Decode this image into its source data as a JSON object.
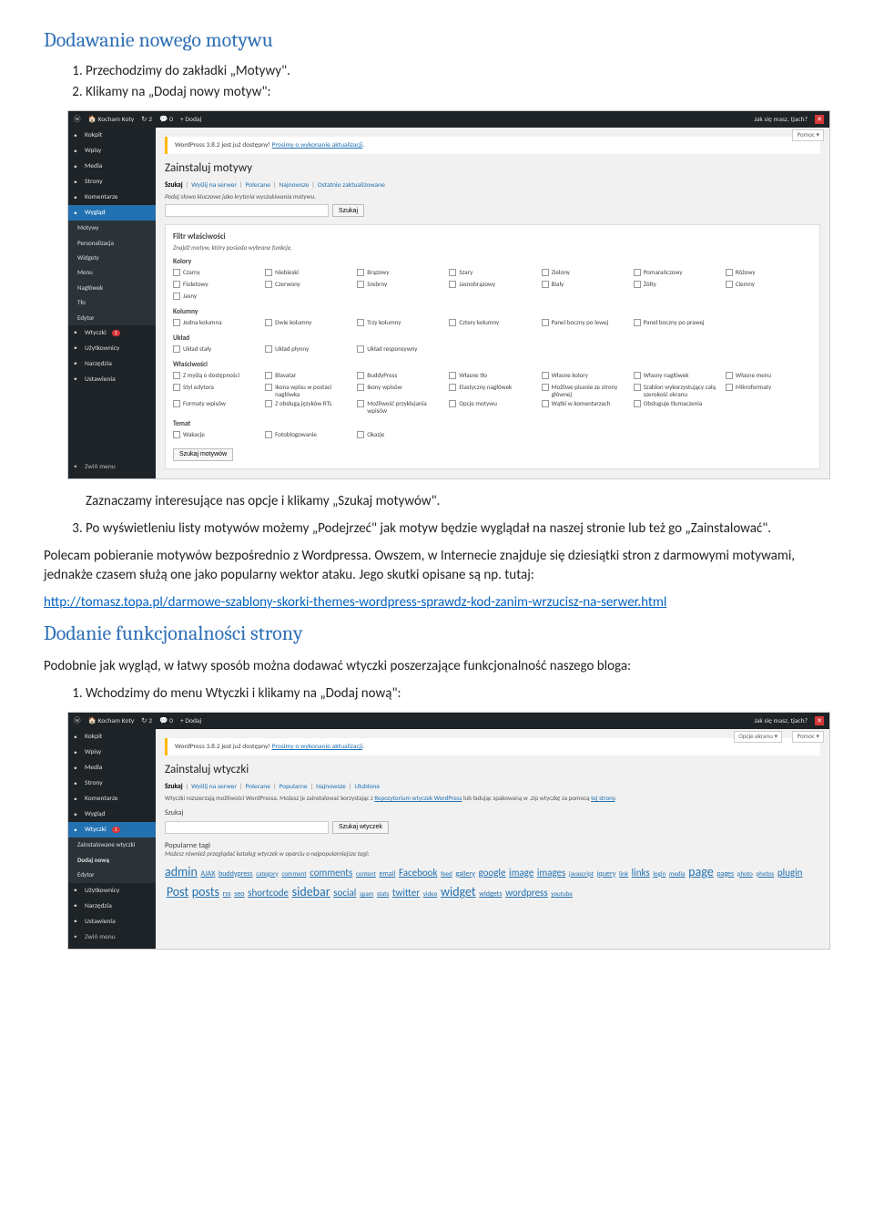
{
  "doc": {
    "h1": "Dodawanie nowego motywu",
    "step1": "Przechodzimy do zakładki „Motywy\".",
    "step2": "Klikamy na „Dodaj nowy motyw\":",
    "after1": "Zaznaczamy interesujące nas opcje i klikamy „Szukaj motywów\".",
    "step3": "Po wyświetleniu listy motywów możemy „Podejrzeć\" jak motyw będzie wyglądał na naszej stronie lub też go „Zainstalować\".",
    "para1": "Polecam pobieranie motywów bezpośrednio z Wordpressa. Owszem, w Internecie znajduje się dziesiątki stron z darmowymi motywami, jednakże czasem służą one jako popularny wektor ataku. Jego skutki opisane są np. tutaj:",
    "link": "http://tomasz.topa.pl/darmowe-szablony-skorki-themes-wordpress-sprawdz-kod-zanim-wrzucisz-na-serwer.html",
    "h2": "Dodanie funkcjonalności strony",
    "para2": "Podobnie jak wygląd, w łatwy sposób można dodawać wtyczki poszerzające funkcjonalność naszego bloga:",
    "lstep1": "Wchodzimy do menu Wtyczki i klikamy na „Dodaj nową\":"
  },
  "shot1": {
    "topbar": {
      "site": "Kocham Koty",
      "comments": "2",
      "updates": "0",
      "add": "Dodaj",
      "greeting": "Jak się masz, tjach?"
    },
    "sidebar": [
      {
        "label": "Kokpit",
        "icon": "dashboard"
      },
      {
        "label": "Wpisy",
        "icon": "pin"
      },
      {
        "label": "Media",
        "icon": "camera"
      },
      {
        "label": "Strony",
        "icon": "pages"
      },
      {
        "label": "Komentarze",
        "icon": "comment"
      },
      {
        "label": "Wygląd",
        "icon": "brush",
        "active": true
      },
      {
        "label": "Motywy",
        "sub": true
      },
      {
        "label": "Personalizacja",
        "sub": true
      },
      {
        "label": "Widgety",
        "sub": true
      },
      {
        "label": "Menu",
        "sub": true
      },
      {
        "label": "Nagłówek",
        "sub": true
      },
      {
        "label": "Tło",
        "sub": true
      },
      {
        "label": "Edytor",
        "sub": true
      },
      {
        "label": "Wtyczki",
        "icon": "plugin",
        "badge": "1"
      },
      {
        "label": "Użytkownicy",
        "icon": "users"
      },
      {
        "label": "Narzędzia",
        "icon": "tools"
      },
      {
        "label": "Ustawienia",
        "icon": "settings"
      },
      {
        "label": "Zwiń menu",
        "icon": "collapse",
        "collapse": true
      }
    ],
    "help": "Pomoc",
    "notice_pre": "WordPress 3.8.2 jest już dostępny! ",
    "notice_link": "Prosimy o wykonanie aktualizacji",
    "title": "Zainstaluj motywy",
    "tabs": [
      "Szukaj",
      "Wyślij na serwer",
      "Polecane",
      "Najnowsze",
      "Ostatnio zaktualizowane"
    ],
    "hint": "Podaj słowo kluczowe jako kryteria wyszukiwania motywu.",
    "search_btn": "Szukaj",
    "filter_title": "Filtr właściwości",
    "filter_hint": "Znajdź motyw, który posiada wybrane funkcje.",
    "groups": [
      {
        "name": "Kolory",
        "items": [
          "Czarny",
          "Niebieski",
          "Brązowy",
          "Szary",
          "Zielony",
          "Pomarańczowy",
          "Różowy",
          "Fioletowy",
          "Czerwony",
          "Srebrny",
          "Jasnobrązowy",
          "Biały",
          "Żółty",
          "Ciemny",
          "Jasny"
        ]
      },
      {
        "name": "Kolumny",
        "items": [
          "Jedna kolumna",
          "Dwie kolumny",
          "Trzy kolumny",
          "Cztery kolumny",
          "Panel boczny po lewej",
          "Panel boczny po prawej"
        ]
      },
      {
        "name": "Układ",
        "items": [
          "Układ stały",
          "Układ płynny",
          "Układ responsywny"
        ]
      },
      {
        "name": "Właściwości",
        "items": [
          "Z myślą o dostępności",
          "Blavatar",
          "BuddyPress",
          "Własne tło",
          "Własne kolory",
          "Własny nagłówek",
          "Własne menu",
          "Styl edytora",
          "Ikona wpisu w postaci nagłówka",
          "Ikony wpisów",
          "Elastyczny nagłówek",
          "Możliwe pisanie ze strony głównej",
          "Szablon wykorzystujący całą szerokość ekranu",
          "Mikroformaty",
          "Formaty wpisów",
          "Z obsługą języków RTL",
          "Możliwość przyklejania wpisów",
          "Opcje motywu",
          "Wątki w komentarzach",
          "Obsługuje tłumaczenia"
        ]
      },
      {
        "name": "Temat",
        "items": [
          "Wakacje",
          "Fotoblogowanie",
          "Okazje"
        ]
      }
    ],
    "submit": "Szukaj motywów"
  },
  "shot2": {
    "topbar": {
      "site": "Kocham Koty",
      "comments": "2",
      "updates": "0",
      "add": "Dodaj",
      "greeting": "Jak się masz, tjach?"
    },
    "sidebar": [
      {
        "label": "Kokpit",
        "icon": "dashboard"
      },
      {
        "label": "Wpisy",
        "icon": "pin"
      },
      {
        "label": "Media",
        "icon": "camera"
      },
      {
        "label": "Strony",
        "icon": "pages"
      },
      {
        "label": "Komentarze",
        "icon": "comment"
      },
      {
        "label": "Wygląd",
        "icon": "brush"
      },
      {
        "label": "Wtyczki",
        "icon": "plugin",
        "badge": "1",
        "active": true
      },
      {
        "label": "Zainstalowane wtyczki",
        "sub": true
      },
      {
        "label": "Dodaj nową",
        "sub": true,
        "bold": true
      },
      {
        "label": "Edytor",
        "sub": true
      },
      {
        "label": "Użytkownicy",
        "icon": "users"
      },
      {
        "label": "Narzędzia",
        "icon": "tools"
      },
      {
        "label": "Ustawienia",
        "icon": "settings"
      },
      {
        "label": "Zwiń menu",
        "icon": "collapse",
        "collapse": true
      }
    ],
    "screen_options": "Opcje ekranu",
    "help": "Pomoc",
    "notice_pre": "WordPress 3.8.2 jest już dostępny! ",
    "notice_link": "Prosimy o wykonanie aktualizacji",
    "title": "Zainstaluj wtyczki",
    "tabs": [
      "Szukaj",
      "Wyślij na serwer",
      "Polecane",
      "Popularne",
      "Najnowsze",
      "Ulubione"
    ],
    "desc_pre": "Wtyczki rozszerzają możliwości WordPressa. Możesz je zainstalować korzystając z ",
    "desc_link": "Repozytorium wtyczek WordPress",
    "desc_post": " lub ładując spakowaną w .zip wtyczkę za pomocą ",
    "desc_link2": "tej strony",
    "desc_dot": ".",
    "search_label": "Szukaj",
    "search_btn": "Szukaj wtyczek",
    "popular_title": "Popularne tagi",
    "popular_hint": "Możesz również przeglądać katalog wtyczek w oparciu o najpopularniejsze tagi:",
    "tags": [
      {
        "t": "admin",
        "s": "big"
      },
      {
        "t": "AJAX",
        "s": "sm"
      },
      {
        "t": "buddypress",
        "s": "sm"
      },
      {
        "t": "category",
        "s": "xs"
      },
      {
        "t": "comment",
        "s": "xs"
      },
      {
        "t": "comments",
        "s": "med"
      },
      {
        "t": "content",
        "s": "xs"
      },
      {
        "t": "email",
        "s": "sm"
      },
      {
        "t": "Facebook",
        "s": "med"
      },
      {
        "t": "feed",
        "s": "xs"
      },
      {
        "t": "gallery",
        "s": "sm"
      },
      {
        "t": "google",
        "s": "med"
      },
      {
        "t": "image",
        "s": "med"
      },
      {
        "t": "images",
        "s": "med"
      },
      {
        "t": "javascript",
        "s": "xs"
      },
      {
        "t": "jquery",
        "s": "sm"
      },
      {
        "t": "link",
        "s": "xs"
      },
      {
        "t": "links",
        "s": "med"
      },
      {
        "t": "login",
        "s": "xs"
      },
      {
        "t": "media",
        "s": "xs"
      },
      {
        "t": "page",
        "s": "big"
      },
      {
        "t": "pages",
        "s": "sm"
      },
      {
        "t": "photo",
        "s": "xs"
      },
      {
        "t": "photos",
        "s": "xs"
      },
      {
        "t": "plugin",
        "s": "med"
      },
      {
        "t": "Post",
        "s": "big"
      },
      {
        "t": "posts",
        "s": "big"
      },
      {
        "t": "rss",
        "s": "sm"
      },
      {
        "t": "seo",
        "s": "sm"
      },
      {
        "t": "shortcode",
        "s": "med"
      },
      {
        "t": "sidebar",
        "s": "big"
      },
      {
        "t": "social",
        "s": "med"
      },
      {
        "t": "spam",
        "s": "xs"
      },
      {
        "t": "stats",
        "s": "xs"
      },
      {
        "t": "twitter",
        "s": "med"
      },
      {
        "t": "video",
        "s": "xs"
      },
      {
        "t": "widget",
        "s": "big"
      },
      {
        "t": "widgets",
        "s": "sm"
      },
      {
        "t": "wordpress",
        "s": "med"
      },
      {
        "t": "youtube",
        "s": "xs"
      }
    ]
  }
}
